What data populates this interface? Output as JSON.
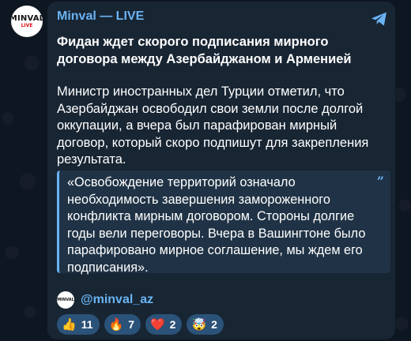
{
  "avatar": {
    "logo_main": "MINVAL",
    "logo_sub": "LIVE"
  },
  "message": {
    "channel_name": "Minval — LIVE",
    "headline": "Фидан ждет скорого подписания мирного договора между Азербайджаном и Арменией",
    "body": "Министр иностранных дел Турции отметил, что Азербайджан освободил свои земли после долгой оккупации, а вчера был парафирован мирный договор, который скоро подпишут для закрепления результата.",
    "quote": "«Освобождение территорий означало необходимость завершения замороженного конфликта мирным договором. Стороны долгие годы вели переговоры. Вчера в Вашингтоне было парафировано мирное соглашение, мы ждем его подписания».",
    "handle": "@minval_az",
    "handle_avatar_text": "MINVAL"
  },
  "reactions": [
    {
      "emoji": "👍",
      "icon": "thumbs-up-icon",
      "count": "11"
    },
    {
      "emoji": "🔥",
      "icon": "fire-icon",
      "count": "7"
    },
    {
      "emoji": "❤️",
      "icon": "heart-icon",
      "count": "2"
    },
    {
      "emoji": "🤯",
      "icon": "mind-blown-icon",
      "count": "2"
    }
  ],
  "colors": {
    "background": "#0e1621",
    "bubble": "#182533",
    "accent": "#6ab3f3",
    "reaction_bg": "#2b5278"
  }
}
